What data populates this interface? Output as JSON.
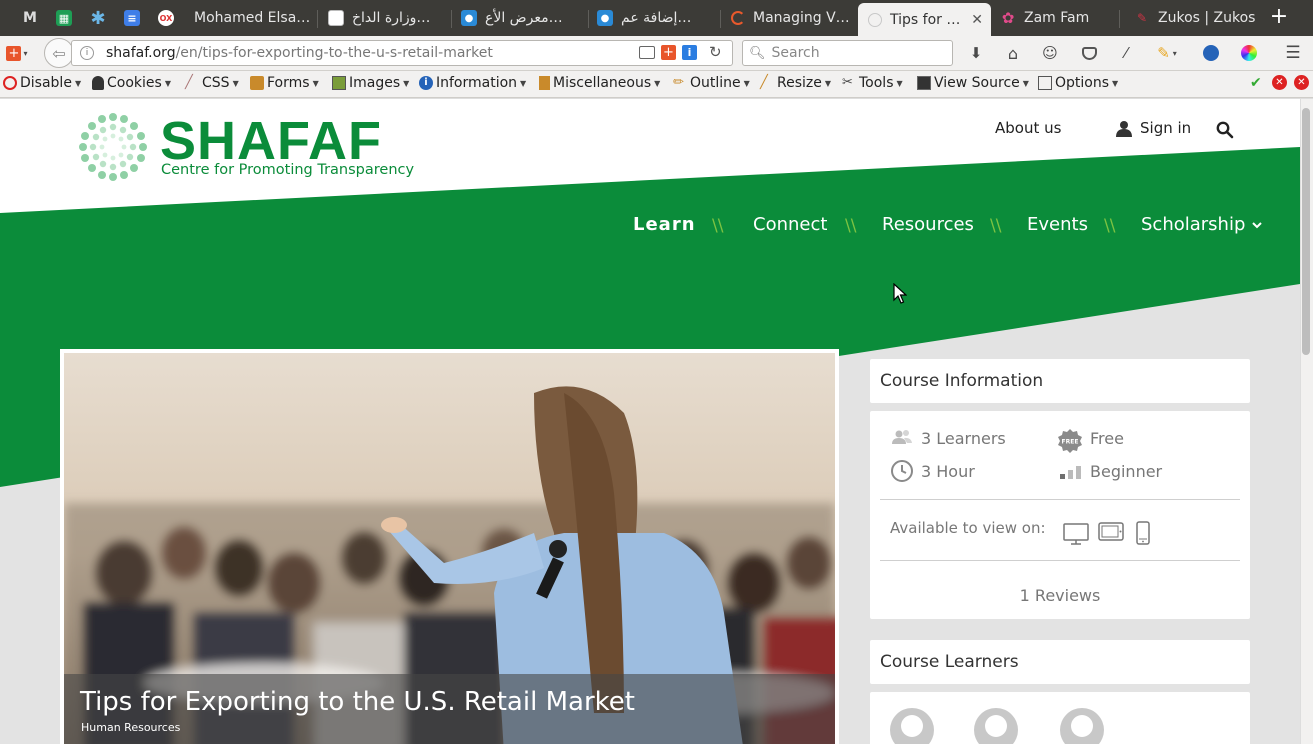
{
  "browser": {
    "tabs": [
      {
        "label": "",
        "icon": "gmail-icon"
      },
      {
        "label": "",
        "icon": "sheets-icon"
      },
      {
        "label": "",
        "icon": "asterisk-icon"
      },
      {
        "label": "",
        "icon": "docs-icon"
      },
      {
        "label": "Mohamed Elsa…",
        "icon": "olx-icon"
      },
      {
        "label": "وزارة الداخ…",
        "icon": "document-icon"
      },
      {
        "label": "معرض الأع…",
        "icon": "circle-app-icon"
      },
      {
        "label": "إضافة عم…",
        "icon": "circle-app-icon"
      },
      {
        "label": "Managing V…",
        "icon": "loading-icon"
      },
      {
        "label": "Tips for …",
        "icon": "blank-page-icon"
      },
      {
        "label": "Zam Fam",
        "icon": "pinwheel-icon"
      },
      {
        "label": "Zukos | Zukos",
        "icon": "zukos-icon"
      }
    ],
    "url_host": "shafaf.org",
    "url_path": "/en/tips-for-exporting-to-the-u-s-retail-market",
    "search_placeholder": "Search",
    "dev_toolbar": [
      "Disable",
      "Cookies",
      "CSS",
      "Forms",
      "Images",
      "Information",
      "Miscellaneous",
      "Outline",
      "Resize",
      "Tools",
      "View Source",
      "Options"
    ]
  },
  "site": {
    "logo_name": "SHAFAF",
    "logo_tagline": "Centre for Promoting Transparency",
    "top_links": {
      "about": "About us",
      "signin": "Sign in"
    },
    "nav": {
      "learn": "Learn",
      "connect": "Connect",
      "resources": "Resources",
      "events": "Events",
      "scholarship": "Scholarship",
      "separator": "\\\\"
    },
    "colors": {
      "brand_green": "#0b8c3a",
      "accent_green": "#6ebe1e"
    }
  },
  "course": {
    "title": "Tips for Exporting to the U.S. Retail Market",
    "category": "Human Resources"
  },
  "info_panel": {
    "title": "Course Information",
    "learners": "3 Learners",
    "price": "Free",
    "free_badge": "FREE",
    "duration": "3 Hour",
    "level": "Beginner",
    "available_label": "Available to view on:",
    "reviews": "1 Reviews"
  },
  "learners_panel": {
    "title": "Course Learners"
  }
}
